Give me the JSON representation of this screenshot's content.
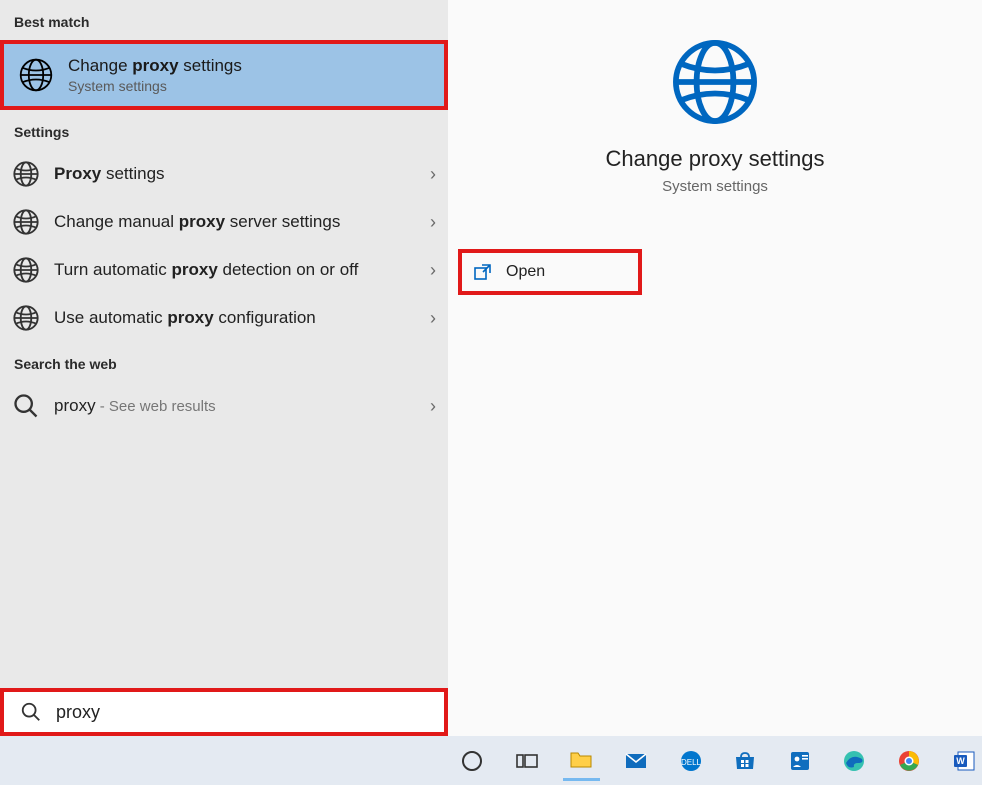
{
  "sections": {
    "best_match": "Best match",
    "settings": "Settings",
    "search_web": "Search the web"
  },
  "best_match_item": {
    "title_pre": "Change ",
    "title_bold": "proxy",
    "title_post": " settings",
    "subtitle": "System settings"
  },
  "settings_items": [
    {
      "pre": "",
      "bold": "Proxy",
      "post": " settings"
    },
    {
      "pre": "Change manual ",
      "bold": "proxy",
      "post": " server settings"
    },
    {
      "pre": "Turn automatic ",
      "bold": "proxy",
      "post": " detection on or off"
    },
    {
      "pre": "Use automatic ",
      "bold": "proxy",
      "post": " configuration"
    }
  ],
  "web_item": {
    "term": "proxy",
    "suffix": " - See web results"
  },
  "preview": {
    "title": "Change proxy settings",
    "subtitle": "System settings"
  },
  "open_action": {
    "label": "Open"
  },
  "search": {
    "value": "proxy"
  },
  "taskbar": {
    "items": [
      "cortana",
      "task-view",
      "explorer",
      "mail",
      "dell",
      "store",
      "feedback",
      "edge",
      "chrome",
      "word"
    ]
  }
}
